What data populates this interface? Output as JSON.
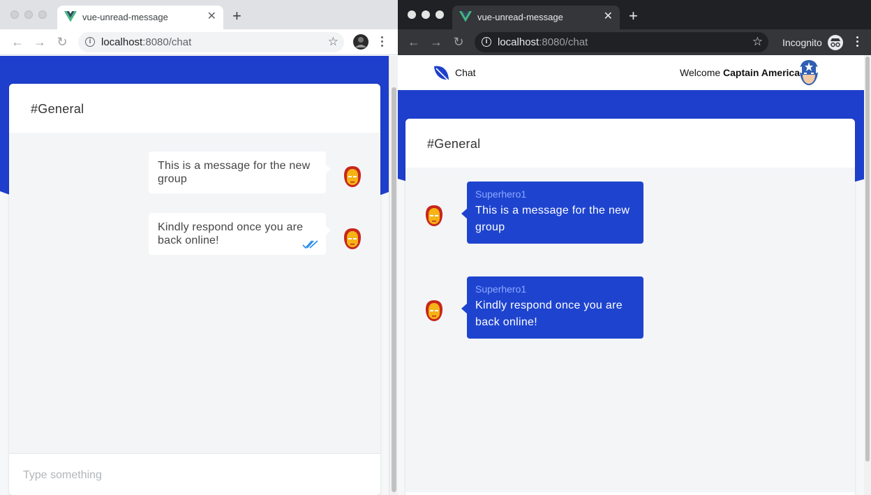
{
  "left_browser": {
    "tab_title": "vue-unread-message",
    "url_host": "localhost",
    "url_rest": ":8080/chat",
    "icons": [
      "vue-logo-icon",
      "close-icon",
      "new-tab-icon",
      "back-icon",
      "forward-icon",
      "reload-icon",
      "info-icon",
      "bookmark-star-icon",
      "profile-avatar-icon",
      "menu-icon"
    ]
  },
  "right_browser": {
    "tab_title": "vue-unread-message",
    "url_host": "localhost",
    "url_rest": ":8080/chat",
    "incognito_label": "Incognito"
  },
  "left_app": {
    "channel": "#General",
    "messages": [
      {
        "text": "This is a message for the new group",
        "read": false
      },
      {
        "text": "Kindly respond once you are back online!",
        "read": true
      }
    ],
    "input_placeholder": "Type something"
  },
  "right_app": {
    "brand": "Chat",
    "welcome_prefix": "Welcome",
    "user_name": "Captain America",
    "channel": "#General",
    "messages": [
      {
        "sender": "Superhero1",
        "text": "This is a message for the new group"
      },
      {
        "sender": "Superhero1",
        "text": "Kindly respond once you are back online!"
      }
    ]
  },
  "colors": {
    "brand_blue": "#1e3fcb",
    "message_blue": "#1e44cf",
    "read_tick": "#2d8ff0"
  }
}
